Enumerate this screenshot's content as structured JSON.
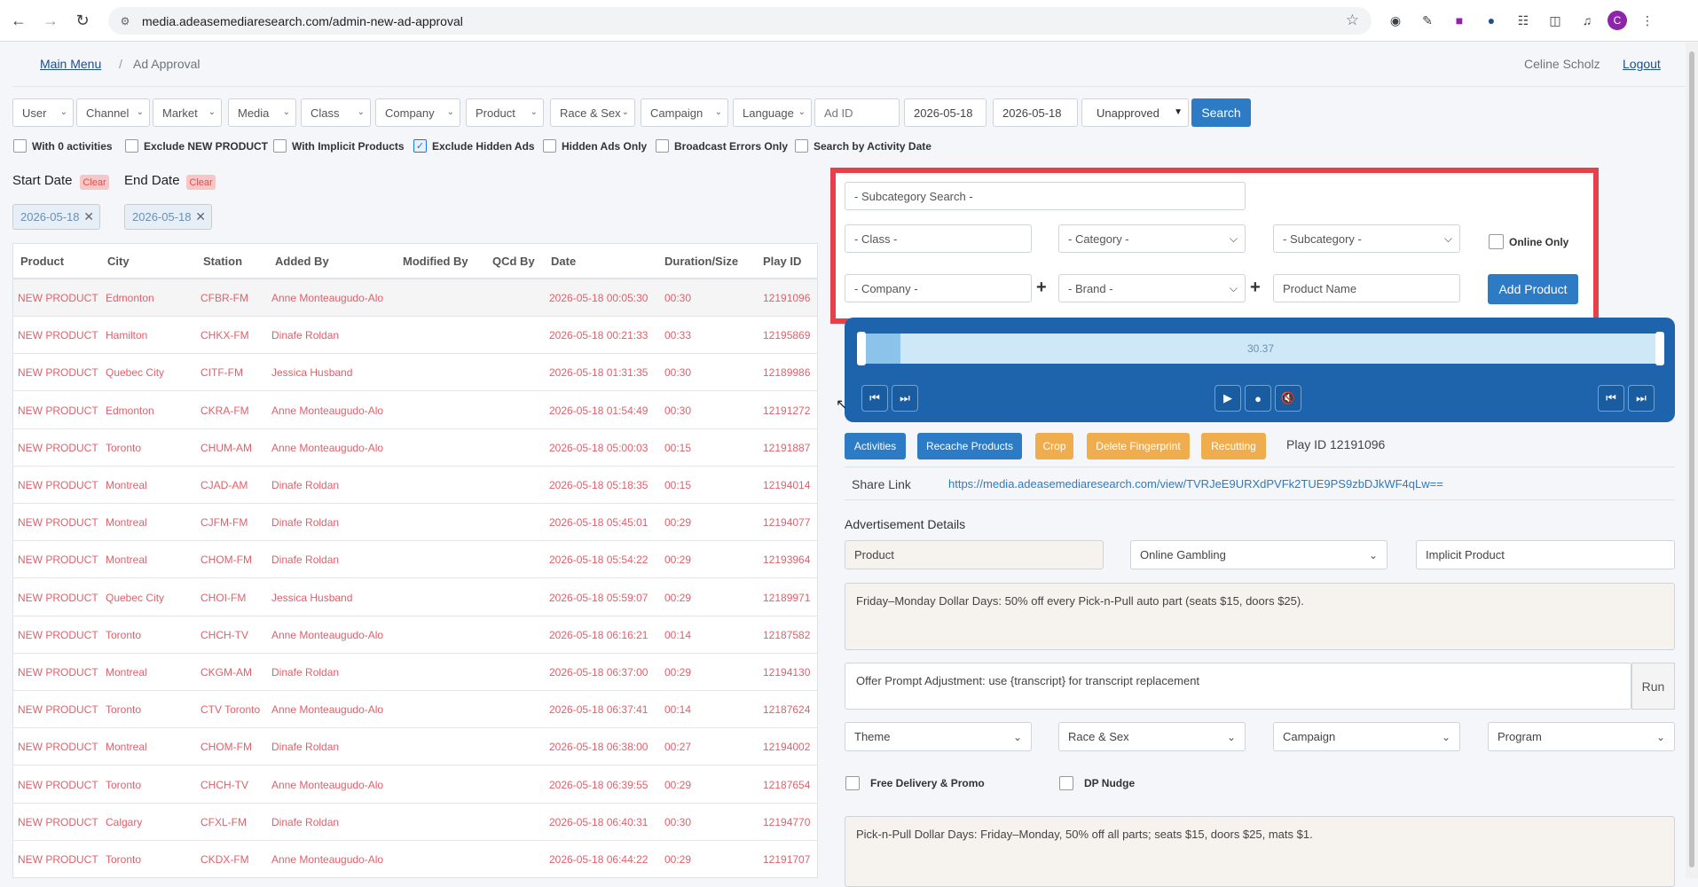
{
  "browser": {
    "url": "media.adeasemediaresearch.com/admin-new-ad-approval",
    "profile_initial": "C"
  },
  "header": {
    "main_menu": "Main Menu",
    "separator": "/",
    "current": "Ad Approval",
    "user": "Celine Scholz",
    "logout": "Logout"
  },
  "filters": {
    "user": "User",
    "channel": "Channel",
    "market": "Market",
    "media": "Media",
    "class": "Class",
    "company": "Company",
    "product": "Product",
    "race_sex": "Race & Sex",
    "campaign": "Campaign",
    "language": "Language",
    "ad_id_placeholder": "Ad ID",
    "start_date": "2026-05-18",
    "end_date": "2026-05-18",
    "status": "Unapproved",
    "search": "Search"
  },
  "checkboxes": [
    {
      "label": "With 0 activities",
      "checked": false
    },
    {
      "label": "Exclude NEW PRODUCT",
      "checked": false
    },
    {
      "label": "With Implicit Products",
      "checked": false
    },
    {
      "label": "Exclude Hidden Ads",
      "checked": true
    },
    {
      "label": "Hidden Ads Only",
      "checked": false
    },
    {
      "label": "Broadcast Errors Only",
      "checked": false
    },
    {
      "label": "Search by Activity Date",
      "checked": false
    }
  ],
  "dates": {
    "start_label": "Start Date",
    "end_label": "End Date",
    "clear": "Clear",
    "start_value": "2026-05-18",
    "end_value": "2026-05-18"
  },
  "table": {
    "headers": [
      "Product",
      "City",
      "Station",
      "Added By",
      "Modified By",
      "QCd By",
      "Date",
      "Duration/Size",
      "Play ID"
    ],
    "rows": [
      [
        "NEW PRODUCT",
        "Edmonton",
        "CFBR-FM",
        "Anne Monteaugudo-Alo",
        "",
        "",
        "2026-05-18 00:05:30",
        "00:30",
        "12191096"
      ],
      [
        "NEW PRODUCT",
        "Hamilton",
        "CHKX-FM",
        "Dinafe Roldan",
        "",
        "",
        "2026-05-18 00:21:33",
        "00:33",
        "12195869"
      ],
      [
        "NEW PRODUCT",
        "Quebec City",
        "CITF-FM",
        "Jessica Husband",
        "",
        "",
        "2026-05-18 01:31:35",
        "00:30",
        "12189986"
      ],
      [
        "NEW PRODUCT",
        "Edmonton",
        "CKRA-FM",
        "Anne Monteaugudo-Alo",
        "",
        "",
        "2026-05-18 01:54:49",
        "00:30",
        "12191272"
      ],
      [
        "NEW PRODUCT",
        "Toronto",
        "CHUM-AM",
        "Anne Monteaugudo-Alo",
        "",
        "",
        "2026-05-18 05:00:03",
        "00:15",
        "12191887"
      ],
      [
        "NEW PRODUCT",
        "Montreal",
        "CJAD-AM",
        "Dinafe Roldan",
        "",
        "",
        "2026-05-18 05:18:35",
        "00:15",
        "12194014"
      ],
      [
        "NEW PRODUCT",
        "Montreal",
        "CJFM-FM",
        "Dinafe Roldan",
        "",
        "",
        "2026-05-18 05:45:01",
        "00:29",
        "12194077"
      ],
      [
        "NEW PRODUCT",
        "Montreal",
        "CHOM-FM",
        "Dinafe Roldan",
        "",
        "",
        "2026-05-18 05:54:22",
        "00:29",
        "12193964"
      ],
      [
        "NEW PRODUCT",
        "Quebec City",
        "CHOI-FM",
        "Jessica Husband",
        "",
        "",
        "2026-05-18 05:59:07",
        "00:29",
        "12189971"
      ],
      [
        "NEW PRODUCT",
        "Toronto",
        "CHCH-TV",
        "Anne Monteaugudo-Alo",
        "",
        "",
        "2026-05-18 06:16:21",
        "00:14",
        "12187582"
      ],
      [
        "NEW PRODUCT",
        "Montreal",
        "CKGM-AM",
        "Dinafe Roldan",
        "",
        "",
        "2026-05-18 06:37:00",
        "00:29",
        "12194130"
      ],
      [
        "NEW PRODUCT",
        "Toronto",
        "CTV Toronto",
        "Anne Monteaugudo-Alo",
        "",
        "",
        "2026-05-18 06:37:41",
        "00:14",
        "12187624"
      ],
      [
        "NEW PRODUCT",
        "Montreal",
        "CHOM-FM",
        "Dinafe Roldan",
        "",
        "",
        "2026-05-18 06:38:00",
        "00:27",
        "12194002"
      ],
      [
        "NEW PRODUCT",
        "Toronto",
        "CHCH-TV",
        "Anne Monteaugudo-Alo",
        "",
        "",
        "2026-05-18 06:39:55",
        "00:29",
        "12187654"
      ],
      [
        "NEW PRODUCT",
        "Calgary",
        "CFXL-FM",
        "Dinafe Roldan",
        "",
        "",
        "2026-05-18 06:40:31",
        "00:30",
        "12194770"
      ],
      [
        "NEW PRODUCT",
        "Toronto",
        "CKDX-FM",
        "Anne Monteaugudo-Alo",
        "",
        "",
        "2026-05-18 06:44:22",
        "00:29",
        "12191707"
      ]
    ]
  },
  "product_form": {
    "subcategory_search": "- Subcategory Search -",
    "class": "- Class -",
    "category": "- Category -",
    "subcategory": "- Subcategory -",
    "online_only": "Online Only",
    "company": "- Company -",
    "brand": "- Brand -",
    "product_name": "Product Name",
    "add_product": "Add Product"
  },
  "player": {
    "time": "30.37",
    "progress": 0.05
  },
  "actions": {
    "activities": "Activities",
    "recache": "Recache Products",
    "crop": "Crop",
    "delete_fp": "Delete Fingerprint",
    "recutting": "Recutting",
    "play_id": "Play ID 12191096"
  },
  "share": {
    "label": "Share Link",
    "url": "https://media.adeasemediaresearch.com/view/TVRJeE9URXdPVFk2TUE9PS9zbDJkWF4qLw=="
  },
  "details": {
    "title": "Advertisement Details",
    "product": "Product",
    "category": "Online Gambling",
    "implicit": "Implicit Product",
    "offer": "Friday–Monday Dollar Days: 50% off every Pick-n-Pull auto part (seats $15, doors $25).",
    "prompt": "Offer Prompt Adjustment: use {transcript} for transcript replacement",
    "run": "Run",
    "theme": "Theme",
    "race_sex": "Race & Sex",
    "campaign": "Campaign",
    "program": "Program",
    "free_delivery": "Free Delivery & Promo",
    "dp_nudge": "DP Nudge",
    "summary": "Pick-n-Pull Dollar Days: Friday–Monday, 50% off all parts; seats $15, doors $25, mats $1."
  }
}
